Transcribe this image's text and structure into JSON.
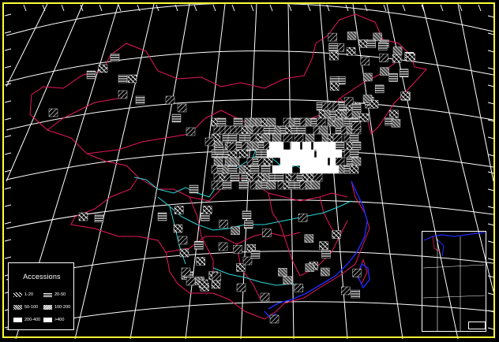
{
  "legend": {
    "title": "Accessions",
    "items": [
      {
        "label": "1-20",
        "pattern": "hatch-sparse"
      },
      {
        "label": "20-50",
        "pattern": "hatch-horizontal"
      },
      {
        "label": "50-100",
        "pattern": "hatch-cross"
      },
      {
        "label": "100-200",
        "pattern": "hatch-dense"
      },
      {
        "label": "200-400",
        "pattern": "solid"
      },
      {
        "label": ">400",
        "pattern": "solid"
      }
    ]
  },
  "colors": {
    "background": "#000000",
    "frame": "#ffff33",
    "graticule": "#ffffff",
    "province_borders": "#e8185a",
    "rivers": "#2bd6d6",
    "coastline": "#1f2cff",
    "cells": "#ffffff"
  },
  "inset": {
    "caption": ""
  }
}
